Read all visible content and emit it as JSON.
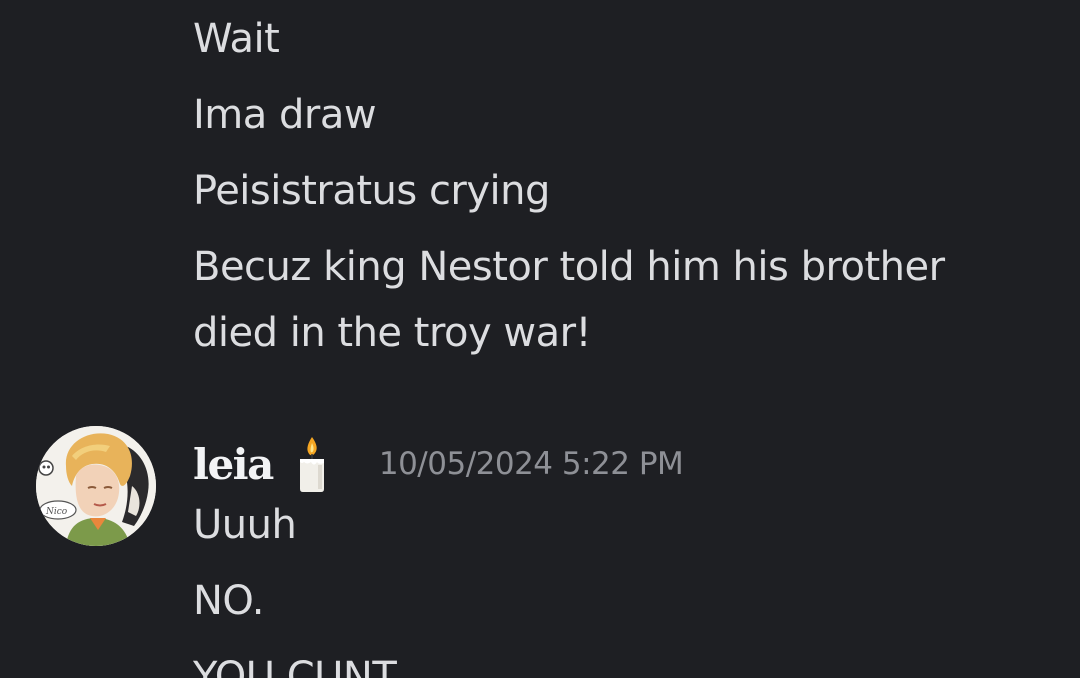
{
  "previous_message": {
    "lines": [
      "Wait",
      "Ima draw",
      "Peisistratus crying",
      "Becuz king Nestor told him his brother",
      "died in the troy war!"
    ]
  },
  "message": {
    "author": "leia",
    "author_icon": "candle-icon",
    "timestamp": "10/05/2024 5:22 PM",
    "lines": [
      "Uuuh",
      "NO.",
      "YOU CUNT"
    ]
  },
  "colors": {
    "background": "#1e1f23",
    "message_text": "#dcdde0",
    "username": "#f2f3f5",
    "timestamp": "#8e9096"
  }
}
